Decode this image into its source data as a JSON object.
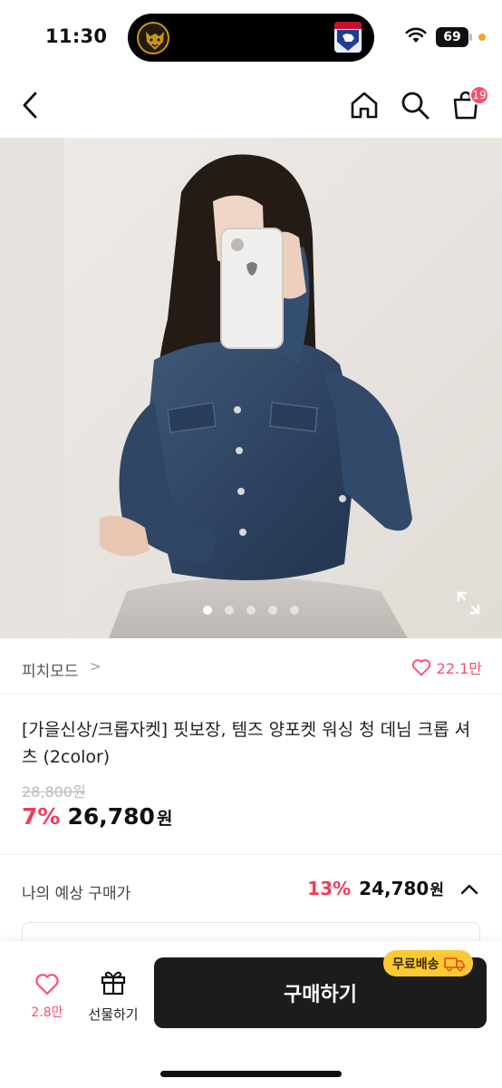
{
  "status_bar": {
    "time": "11:30",
    "battery": "69"
  },
  "nav": {
    "cart_count": "19"
  },
  "gallery": {
    "total_images": 5,
    "active_index": 0
  },
  "brand": {
    "name": "피치모드",
    "chevron": ">",
    "like_count": "22.1만"
  },
  "product": {
    "title": "[가을신상/크롭자켓] 핏보장, 템즈 양포켓 워싱 청 데님 크롭 셔츠 (2color)",
    "original_price": "28,800원",
    "discount": "7%",
    "sale_price": "26,780",
    "currency": "원"
  },
  "expected_price": {
    "label": "나의 예상 구매가",
    "discount": "13%",
    "price": "24,780",
    "currency": "원"
  },
  "bottom_bar": {
    "like_count": "2.8만",
    "gift_label": "선물하기",
    "buy_label": "구매하기",
    "free_shipping": "무료배송"
  },
  "colors": {
    "accent": "#f23b5a",
    "badge": "#ff4d6d",
    "free_shipping_bg": "#fcc934",
    "buy_button": "#1c1c1c"
  }
}
